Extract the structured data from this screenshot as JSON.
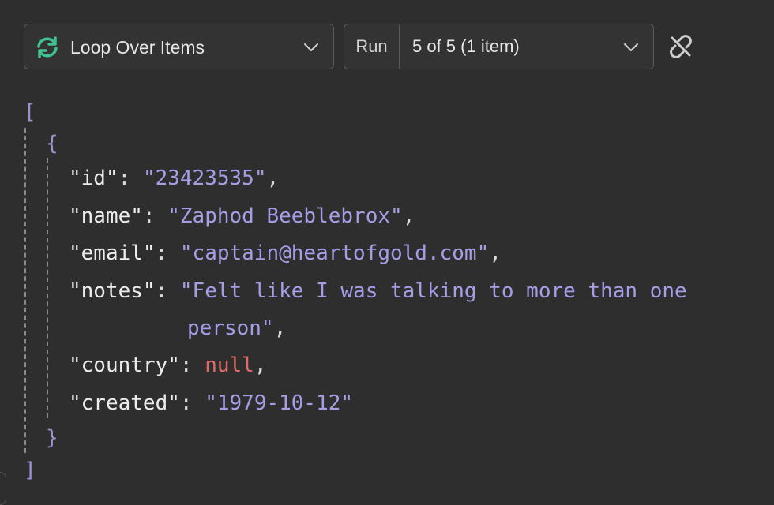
{
  "toolbar": {
    "node_name": "Loop Over Items",
    "node_icon": "loop-refresh-icon",
    "run_label": "Run",
    "run_value": "5 of 5 (1 item)",
    "unlink_icon": "unlink-icon",
    "accent": "#3ec28f"
  },
  "json_output": {
    "open_array": "[",
    "open_object": "{",
    "close_object": "}",
    "close_array": "]",
    "fields": [
      {
        "key": "\"id\"",
        "value": "\"23423535\"",
        "type": "string"
      },
      {
        "key": "\"name\"",
        "value": "\"Zaphod Beeblebrox\"",
        "type": "string"
      },
      {
        "key": "\"email\"",
        "value": "\"captain@heartofgold.com\"",
        "type": "string"
      },
      {
        "key": "\"notes\"",
        "value": "\"Felt like I was talking to more than one",
        "value_cont": "person\"",
        "type": "string"
      },
      {
        "key": "\"country\"",
        "value": "null",
        "type": "null"
      },
      {
        "key": "\"created\"",
        "value": "\"1979-10-12\"",
        "type": "string"
      }
    ]
  }
}
